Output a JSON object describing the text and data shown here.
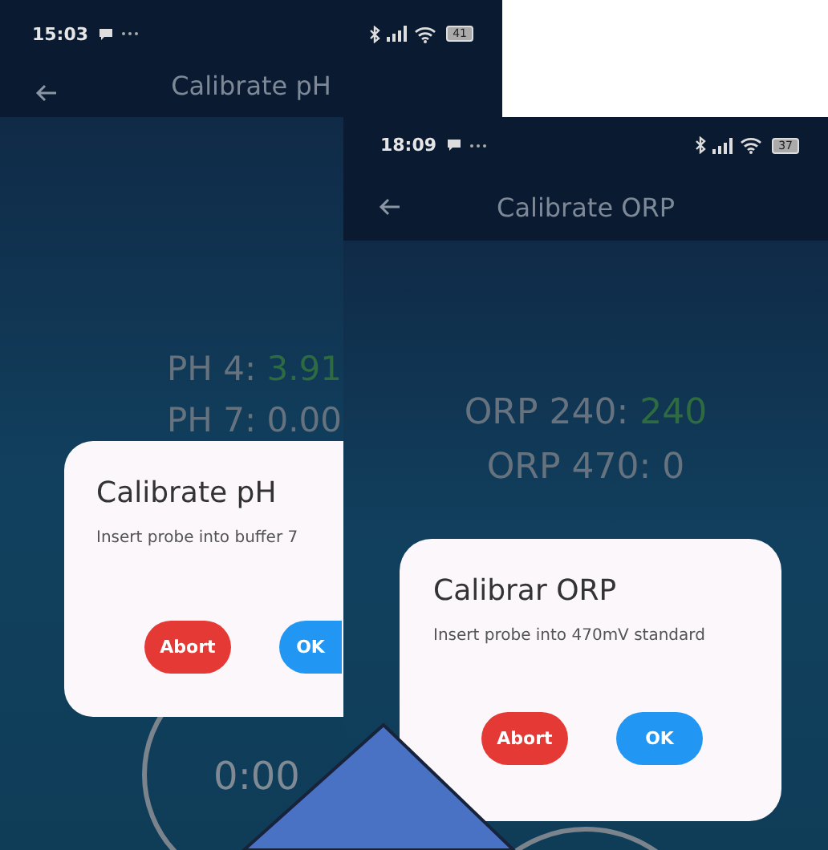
{
  "phones": [
    {
      "status_bar": {
        "time": "15:03",
        "battery": "41"
      },
      "title": "Calibrate pH",
      "readings": [
        {
          "label": "PH 4: ",
          "value": "3.91",
          "calibrated": true
        },
        {
          "label": "PH 7: ",
          "value": "0.00",
          "calibrated": false
        }
      ],
      "timer": "0:00",
      "dialog": {
        "title": "Calibrate pH",
        "message": "Insert probe into buffer 7",
        "buttons": [
          {
            "label": "Abort",
            "kind": "abort"
          },
          {
            "label": "OK",
            "kind": "ok"
          }
        ]
      }
    },
    {
      "status_bar": {
        "time": "18:09",
        "battery": "37"
      },
      "title": "Calibrate ORP",
      "readings": [
        {
          "label": "ORP 240: ",
          "value": "240",
          "calibrated": true
        },
        {
          "label": "ORP 470: ",
          "value": "0",
          "calibrated": false
        }
      ],
      "dialog": {
        "title": "Calibrar ORP",
        "message": "Insert probe into 470mV standard",
        "buttons": [
          {
            "label": "Abort",
            "kind": "abort"
          },
          {
            "label": "OK",
            "kind": "ok"
          }
        ]
      }
    }
  ]
}
